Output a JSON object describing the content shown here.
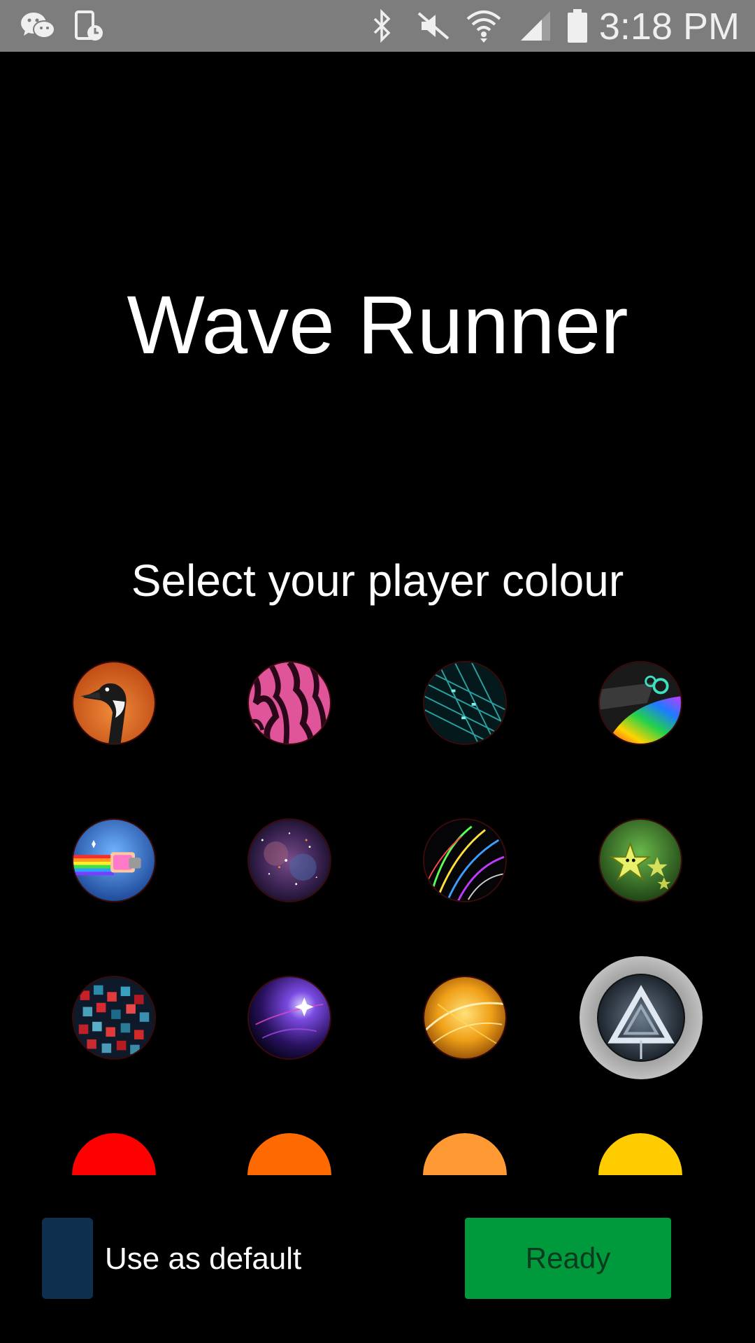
{
  "status_bar": {
    "time": "3:18 PM",
    "icons": [
      "wechat-icon",
      "phone-clock-icon",
      "bluetooth-icon",
      "mute-icon",
      "wifi-icon",
      "signal-icon",
      "battery-icon"
    ],
    "background": "#7d7d7d"
  },
  "app": {
    "title": "Wave Runner",
    "subtitle": "Select your player colour"
  },
  "swatches": [
    {
      "name": "goose"
    },
    {
      "name": "pink-zebra"
    },
    {
      "name": "teal-matrix"
    },
    {
      "name": "rainbow-creature"
    },
    {
      "name": "nyan-cat"
    },
    {
      "name": "galaxy"
    },
    {
      "name": "neon-waves"
    },
    {
      "name": "green-stars"
    },
    {
      "name": "red-cubes"
    },
    {
      "name": "purple-nebula"
    },
    {
      "name": "golden-swirl"
    },
    {
      "name": "silver-triangle",
      "selected": true
    },
    {
      "name": "red",
      "color": "#ff0000"
    },
    {
      "name": "orange",
      "color": "#ff6a00"
    },
    {
      "name": "light-orange",
      "color": "#ff9933"
    },
    {
      "name": "yellow",
      "color": "#ffcc00"
    }
  ],
  "footer": {
    "default_label": "Use as default",
    "ready_label": "Ready",
    "ready_color": "#009a3c",
    "toggle_color": "#0f2f4f"
  }
}
